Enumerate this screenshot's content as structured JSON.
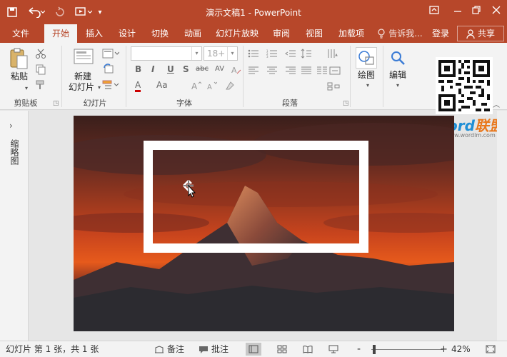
{
  "app": {
    "window_title": "演示文稿1 - PowerPoint",
    "accent_color": "#b7472a"
  },
  "quick_access": {
    "save_icon": "save-icon",
    "undo_icon": "undo-icon",
    "redo_icon": "redo-icon",
    "present_icon": "present-from-start-icon",
    "customize_icon": "customize-caret-icon"
  },
  "window_controls": {
    "ribbon_display_icon": "ribbon-display-icon",
    "minimize_icon": "minimize-icon",
    "restore_icon": "restore-icon",
    "close_icon": "close-icon"
  },
  "tabs": [
    {
      "label": "文件",
      "active": false
    },
    {
      "label": "开始",
      "active": true
    },
    {
      "label": "插入",
      "active": false
    },
    {
      "label": "设计",
      "active": false
    },
    {
      "label": "切换",
      "active": false
    },
    {
      "label": "动画",
      "active": false
    },
    {
      "label": "幻灯片放映",
      "active": false
    },
    {
      "label": "审阅",
      "active": false
    },
    {
      "label": "视图",
      "active": false
    },
    {
      "label": "加载项",
      "active": false
    }
  ],
  "tell_me": {
    "icon": "lightbulb-icon",
    "label": "告诉我..."
  },
  "account": {
    "sign_in": "登录",
    "share": "共享",
    "share_icon": "user-icon"
  },
  "ribbon": {
    "clipboard": {
      "paste": "粘贴",
      "group_label": "剪贴板"
    },
    "slides": {
      "new_slide_line1": "新建",
      "new_slide_line2": "幻灯片",
      "group_label": "幻灯片"
    },
    "font": {
      "size_placeholder": "18+",
      "bold": "B",
      "italic": "I",
      "underline": "U",
      "shadow": "S",
      "strike": "abc",
      "spacing": "AV",
      "color": "A",
      "case": "Aa",
      "group_label": "字体"
    },
    "paragraph": {
      "group_label": "段落"
    },
    "drawing": {
      "label": "绘图"
    },
    "editing": {
      "label": "编辑"
    }
  },
  "brand": {
    "word": "Word",
    "lianmeng": "联盟",
    "site": "www.wordlm.com"
  },
  "thumbnails": {
    "label": "缩略图"
  },
  "status": {
    "slide_info": "幻灯片 第 1 张，共 1 张",
    "notes": "备注",
    "comments": "批注",
    "zoom_percent": "42%",
    "zoom_minus": "-",
    "zoom_plus": "+"
  }
}
